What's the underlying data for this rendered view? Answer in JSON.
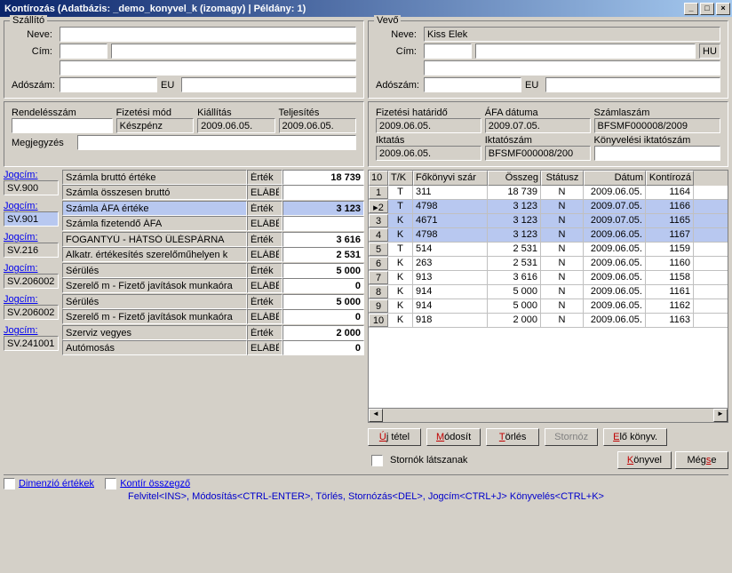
{
  "title": "Kontírozás  (Adatbázis: _demo_konyvel_k (izomagy) | Példány: 1)",
  "szallito": {
    "title": "Szállító",
    "neve_lbl": "Neve:",
    "cim_lbl": "Cím:",
    "adoszam_lbl": "Adószám:",
    "eu_lbl": "EU",
    "neve": "",
    "cim1": "",
    "cim2": "",
    "cim3": "",
    "adoszam": "",
    "eu": ""
  },
  "vevo": {
    "title": "Vevő",
    "neve_lbl": "Neve:",
    "cim_lbl": "Cím:",
    "adoszam_lbl": "Adószám:",
    "eu_lbl": "EU",
    "neve": "Kiss Elek",
    "cim1": "",
    "cim2": "",
    "cim3": "",
    "hu": "HU",
    "adoszam": "",
    "eu": ""
  },
  "mid": {
    "rendelesszam_lbl": "Rendelésszám",
    "rendelesszam": "",
    "fizmod_lbl": "Fizetési mód",
    "fizmod": "Készpénz",
    "kiallitas_lbl": "Kiállítás",
    "kiallitas": "2009.06.05.",
    "teljesites_lbl": "Teljesítés",
    "teljesites": "2009.06.05.",
    "megjegyzes_lbl": "Megjegyzés",
    "megjegyzes": "",
    "fizhat_lbl": "Fizetési határidő",
    "fizhat": "2009.06.05.",
    "afadat_lbl": "ÁFA dátuma",
    "afadat": "2009.07.05.",
    "szamlaszam_lbl": "Számlaszám",
    "szamlaszam": "BFSMF000008/2009",
    "iktatas_lbl": "Iktatás",
    "iktatas": "2009.06.05.",
    "iktatoszam_lbl": "Iktatószám",
    "iktatoszam": "BFSMF000008/200",
    "konyviktat_lbl": "Könyvelési iktatószám",
    "konyviktat": ""
  },
  "jog": {
    "lbl": "Jogcím:",
    "ertek_lbl": "Érték",
    "elabe_lbl": "ELÁBÉ",
    "items": [
      {
        "code": "SV.900",
        "d1": "Számla bruttó értéke",
        "d2": "Számla összesen bruttó",
        "v1": "18 739",
        "v2": "",
        "sel": false
      },
      {
        "code": "SV.901",
        "d1": "Számla ÁFA értéke",
        "d2": "Számla fizetendő ÁFA",
        "v1": "3 123",
        "v2": "",
        "sel": true
      },
      {
        "code": "SV.216",
        "d1": "FOGANTYÚ - HÁTSÓ ÜLÉSPÁRNA",
        "d2": "Alkatr. értékesítés szerelőműhelyen k",
        "v1": "3 616",
        "v2": "2 531",
        "sel": false
      },
      {
        "code": "SV.206002",
        "d1": "Sérülés",
        "d2": "Szerelő m - Fizető javítások munkaóra",
        "v1": "5 000",
        "v2": "0",
        "sel": false
      },
      {
        "code": "SV.206002",
        "d1": "Sérülés",
        "d2": "Szerelő m - Fizető javítások munkaóra",
        "v1": "5 000",
        "v2": "0",
        "sel": false
      },
      {
        "code": "SV.241001",
        "d1": "Szerviz vegyes",
        "d2": "Autómosás",
        "v1": "2 000",
        "v2": "0",
        "sel": false
      }
    ]
  },
  "grid": {
    "cols": [
      "10",
      "T/K",
      "Főkönyvi szár",
      "Összeg",
      "Státusz",
      "Dátum",
      "Kontírozá"
    ],
    "rows": [
      {
        "n": "1",
        "tk": "T",
        "fk": "311",
        "o": "18 739",
        "s": "N",
        "d": "2009.06.05.",
        "k": "1164",
        "sel": false
      },
      {
        "n": "2",
        "tk": "T",
        "fk": "4798",
        "o": "3 123",
        "s": "N",
        "d": "2009.07.05.",
        "k": "1166",
        "sel": true,
        "cur": true
      },
      {
        "n": "3",
        "tk": "K",
        "fk": "4671",
        "o": "3 123",
        "s": "N",
        "d": "2009.07.05.",
        "k": "1165",
        "sel": true
      },
      {
        "n": "4",
        "tk": "K",
        "fk": "4798",
        "o": "3 123",
        "s": "N",
        "d": "2009.06.05.",
        "k": "1167",
        "sel": true
      },
      {
        "n": "5",
        "tk": "T",
        "fk": "514",
        "o": "2 531",
        "s": "N",
        "d": "2009.06.05.",
        "k": "1159",
        "sel": false
      },
      {
        "n": "6",
        "tk": "K",
        "fk": "263",
        "o": "2 531",
        "s": "N",
        "d": "2009.06.05.",
        "k": "1160",
        "sel": false
      },
      {
        "n": "7",
        "tk": "K",
        "fk": "913",
        "o": "3 616",
        "s": "N",
        "d": "2009.06.05.",
        "k": "1158",
        "sel": false
      },
      {
        "n": "8",
        "tk": "K",
        "fk": "914",
        "o": "5 000",
        "s": "N",
        "d": "2009.06.05.",
        "k": "1161",
        "sel": false
      },
      {
        "n": "9",
        "tk": "K",
        "fk": "914",
        "o": "5 000",
        "s": "N",
        "d": "2009.06.05.",
        "k": "1162",
        "sel": false
      },
      {
        "n": "10",
        "tk": "K",
        "fk": "918",
        "o": "2 000",
        "s": "N",
        "d": "2009.06.05.",
        "k": "1163",
        "sel": false
      }
    ]
  },
  "buttons": {
    "ujtetel": "j tétel",
    "ujtetel_h": "Ú",
    "modosit": "ódosít",
    "modosit_h": "M",
    "torles": "örlés",
    "torles_h": "T",
    "stornoz": "tornóz",
    "stornoz_h": "S",
    "elokonyv": "lő könyv.",
    "elokonyv_h": "E",
    "konyvel": "önyvel",
    "konyvel_h": "K",
    "megse": "Még",
    "megse_h": "s",
    "megse2": "e"
  },
  "stornok": "Stornók látszanak",
  "bottom": {
    "dim": "Dimenzió értékek",
    "kontir": "Kontír összegző"
  },
  "footer": "Felvitel<INS>, Módosítás<CTRL-ENTER>, Törlés, Stornózás<DEL>, Jogcím<CTRL+J> Könyvelés<CTRL+K>"
}
